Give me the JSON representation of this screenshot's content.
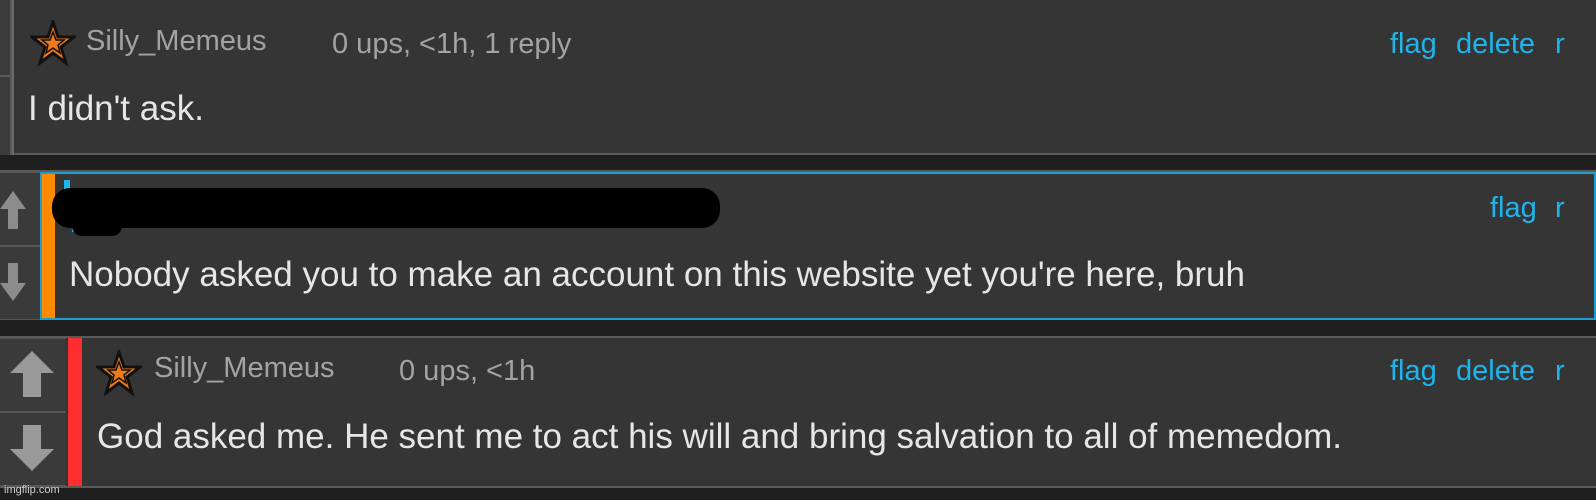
{
  "comments": [
    {
      "username": "Silly_Memeus",
      "meta": "0 ups, <1h, 1 reply",
      "actions": {
        "flag": "flag",
        "delete": "delete",
        "more": "r"
      },
      "body": "I didn't ask."
    },
    {
      "username": "",
      "meta": "",
      "actions": {
        "flag": "flag",
        "more": "r"
      },
      "body": "Nobody asked you to make an account on this website yet you're here, bruh"
    },
    {
      "username": "Silly_Memeus",
      "meta": "0 ups, <1h",
      "actions": {
        "flag": "flag",
        "delete": "delete",
        "more": "r"
      },
      "body": "God asked me. He sent me to act his will and bring salvation to all of memedom."
    }
  ],
  "watermark": "imgflip.com",
  "colors": {
    "background": "#353535",
    "link": "#1eb4ec",
    "username": "#a3a3a3",
    "text": "#e6e6e6",
    "orange_bar": "#ff8a00",
    "red_bar": "#ff2e2e",
    "highlight_border": "#1f9fd0"
  },
  "icons": {
    "user_badge": "star-icon",
    "upvote": "up-arrow-icon",
    "downvote": "down-arrow-icon"
  }
}
